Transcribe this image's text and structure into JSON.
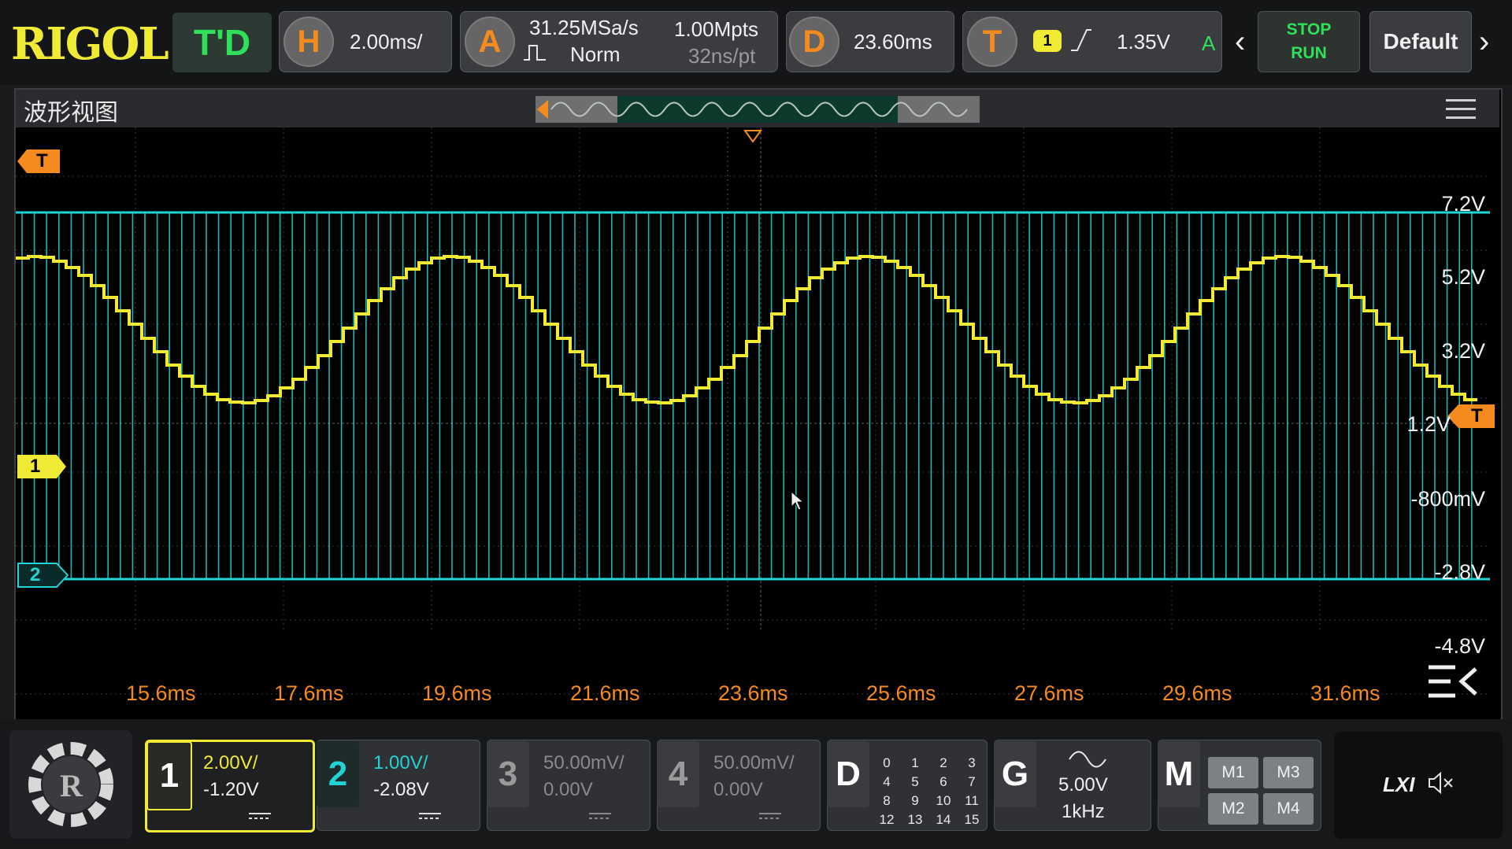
{
  "brand": "RIGOL",
  "mode": "T'D",
  "horizontal": {
    "key": "H",
    "scale": "2.00ms/"
  },
  "acquire": {
    "key": "A",
    "sample_rate": "31.25MSa/s",
    "mode": "Norm",
    "memory_depth": "1.00Mpts",
    "time_per_point": "32ns/pt"
  },
  "delay": {
    "key": "D",
    "offset": "23.60ms"
  },
  "trigger": {
    "key": "T",
    "source": "1",
    "level": "1.35V",
    "sweep": "A"
  },
  "run_control": {
    "stop": "STOP",
    "run": "RUN"
  },
  "default_label": "Default",
  "window": {
    "title": "波形视图"
  },
  "plot": {
    "time_labels": [
      "15.6ms",
      "17.6ms",
      "19.6ms",
      "21.6ms",
      "23.6ms",
      "25.6ms",
      "27.6ms",
      "29.6ms",
      "31.6ms"
    ],
    "volt_labels": [
      "7.2V",
      "5.2V",
      "3.2V",
      "1.2V",
      "-800mV",
      "-2.8V",
      "-4.8V"
    ],
    "ch1_marker": "1",
    "ch2_marker": "2",
    "trig_marker": "T"
  },
  "channels": [
    {
      "num": "1",
      "scale": "2.00V/",
      "offset": "-1.20V",
      "color": "#f1ea35",
      "active": true
    },
    {
      "num": "2",
      "scale": "1.00V/",
      "offset": "-2.08V",
      "color": "#22d3d3",
      "active": true
    },
    {
      "num": "3",
      "scale": "50.00mV/",
      "offset": "0.00V",
      "color": "#8a8a8a",
      "active": false
    },
    {
      "num": "4",
      "scale": "50.00mV/",
      "offset": "0.00V",
      "color": "#8a8a8a",
      "active": false
    }
  ],
  "digital": {
    "key": "D",
    "bits": [
      "0",
      "1",
      "2",
      "3",
      "4",
      "5",
      "6",
      "7",
      "8",
      "9",
      "10",
      "11",
      "12",
      "13",
      "14",
      "15"
    ]
  },
  "generator": {
    "key": "G",
    "amplitude": "5.00V",
    "frequency": "1kHz"
  },
  "math": {
    "key": "M",
    "items": [
      "M1",
      "M3",
      "M2",
      "M4"
    ]
  },
  "lxi": "LXI",
  "colors": {
    "ch1": "#f1ea35",
    "ch2": "#22d3d3",
    "accent": "#f58a1f",
    "run_green": "#2fe05a"
  }
}
